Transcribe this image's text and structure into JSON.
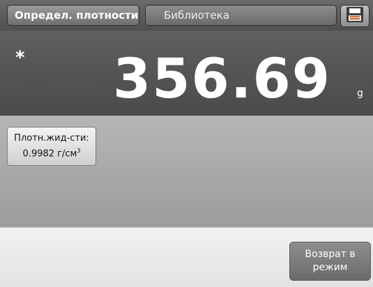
{
  "tabs": {
    "active_label": "Определ. плотности",
    "library_label": "Библиотека"
  },
  "weighing": {
    "stable_marker": "*",
    "value": "356.69",
    "unit": "g"
  },
  "density_field": {
    "label": "Плотн.жид-сти:",
    "value": "0.9982 г/см",
    "unit_superscript": "3"
  },
  "actions": {
    "return_line1": "Возврат в",
    "return_line2": "режим"
  },
  "icons": {
    "save": "save-icon"
  },
  "colors": {
    "topbar": "#505050",
    "weigh_panel": "#4a4a4a",
    "content_panel": "#a8a8a8"
  }
}
